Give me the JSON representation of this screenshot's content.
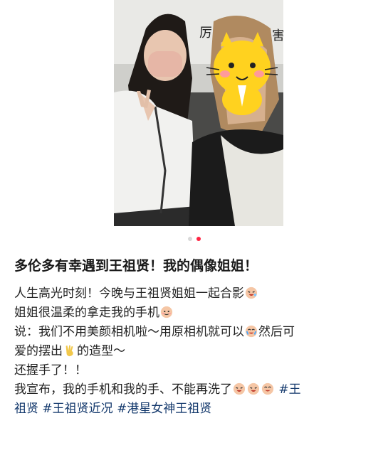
{
  "photo": {
    "overlay_text_left": "厉",
    "overlay_text_right": "害",
    "icons": [
      "cartoon-cat-sticker-icon"
    ]
  },
  "carousel": {
    "total": 2,
    "active_index": 1
  },
  "post": {
    "title": "多伦多有幸遇到王祖贤！我的偶像姐姐！",
    "line1": "人生高光时刻！今晚与王祖贤姐姐一起合影",
    "line2": "姐姐很温柔的拿走我的手机",
    "line3": "说：我们不用美颜相机啦～用原相机就可以",
    "line3_tail": "然后可",
    "line4_a": "爱的摆出",
    "line4_b": "的造型～",
    "line5": "还握手了！！",
    "line6": "我宣布，我的手机和我的手、不能再洗了",
    "hashtags": [
      "#王",
      "祖贤",
      "#王祖贤近况",
      "#港星女神王祖贤"
    ],
    "icons": [
      "laughing-face-icon",
      "smiling-face-icon",
      "crying-laugh-face-icon",
      "victory-hand-icon"
    ]
  },
  "colors": {
    "accent": "#ff2442",
    "hashtag": "#13386c"
  }
}
